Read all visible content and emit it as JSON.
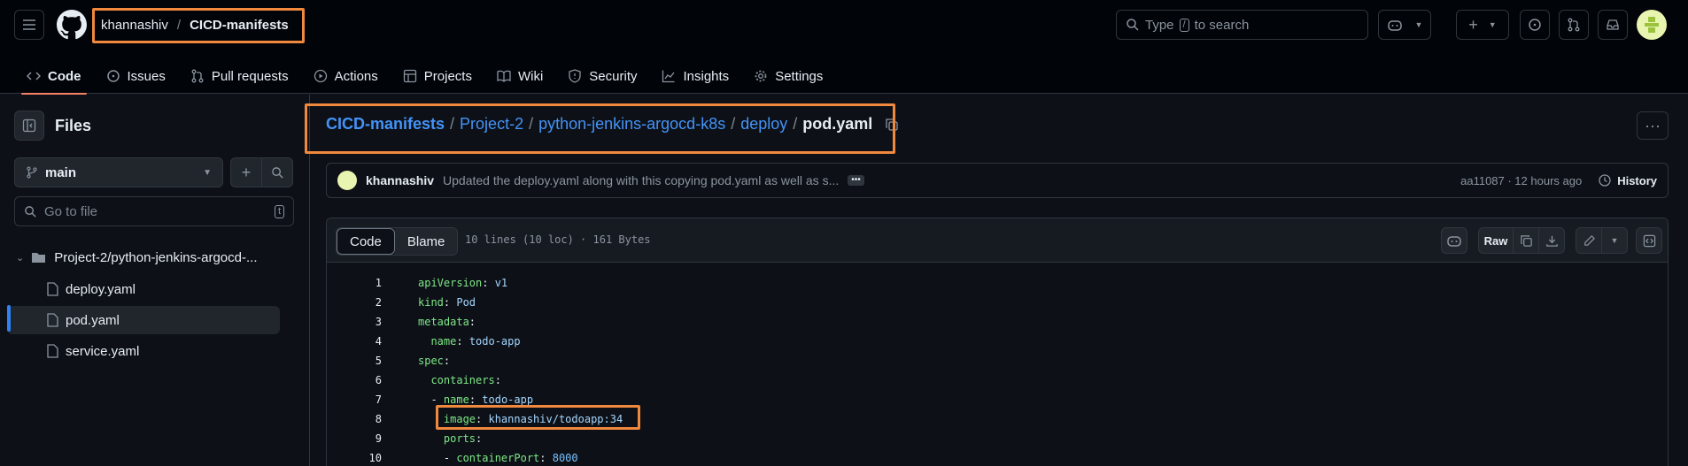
{
  "header": {
    "owner": "khannashiv",
    "separator": "/",
    "repo": "CICD-manifests",
    "search_placeholder_pre": "Type",
    "search_key": "/",
    "search_placeholder_post": "to search"
  },
  "nav": {
    "code": "Code",
    "issues": "Issues",
    "pulls": "Pull requests",
    "actions": "Actions",
    "projects": "Projects",
    "wiki": "Wiki",
    "security": "Security",
    "insights": "Insights",
    "settings": "Settings"
  },
  "sidebar": {
    "title": "Files",
    "branch": "main",
    "goto_placeholder": "Go to file",
    "goto_key": "t",
    "folder": "Project-2/python-jenkins-argocd-...",
    "files": [
      "deploy.yaml",
      "pod.yaml",
      "service.yaml"
    ]
  },
  "breadcrumb": {
    "repo": "CICD-manifests",
    "p1": "Project-2",
    "p2": "python-jenkins-argocd-k8s",
    "p3": "deploy",
    "file": "pod.yaml"
  },
  "commit": {
    "author": "khannashiv",
    "message": "Updated the deploy.yaml along with this copying pod.yaml as well as s...",
    "hash_time": "aa11087 · 12 hours ago",
    "history": "History"
  },
  "file": {
    "tab_code": "Code",
    "tab_blame": "Blame",
    "meta": "10 lines (10 loc) · 161 Bytes",
    "raw": "Raw"
  },
  "code_lines": [
    {
      "n": "1",
      "key": "apiVersion",
      "val": "v1",
      "indent": ""
    },
    {
      "n": "2",
      "key": "kind",
      "val": "Pod",
      "indent": ""
    },
    {
      "n": "3",
      "key": "metadata",
      "val": "",
      "indent": ""
    },
    {
      "n": "4",
      "key": "name",
      "val": "todo-app",
      "indent": "  "
    },
    {
      "n": "5",
      "key": "spec",
      "val": "",
      "indent": ""
    },
    {
      "n": "6",
      "key": "containers",
      "val": "",
      "indent": "  "
    },
    {
      "n": "7",
      "key": "name",
      "val": "todo-app",
      "indent": "  - "
    },
    {
      "n": "8",
      "key": "image",
      "val": "khannashiv/todoapp:34",
      "indent": "    "
    },
    {
      "n": "9",
      "key": "ports",
      "val": "",
      "indent": "    "
    },
    {
      "n": "10",
      "key": "containerPort",
      "val": "8000",
      "indent": "    - "
    }
  ],
  "colors": {
    "highlight": "#f0883e",
    "link": "#4493f8",
    "yaml_key": "#7ee787",
    "yaml_value": "#a5d6ff"
  }
}
